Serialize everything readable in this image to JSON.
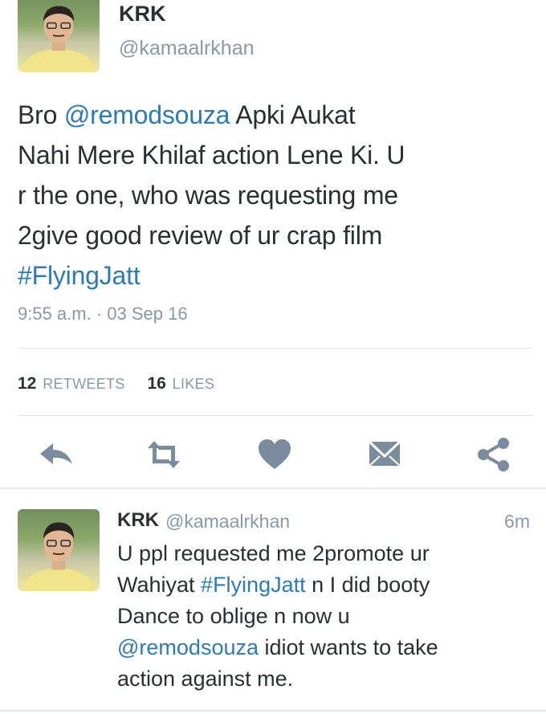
{
  "tweet": {
    "author_name": "KRK",
    "author_handle": "@kamaalrkhan",
    "text_lines": [
      [
        {
          "t": "Bro ",
          "link": false
        },
        {
          "t": "@remodsouza",
          "link": true
        },
        {
          "t": " Apki Aukat",
          "link": false
        }
      ],
      [
        {
          "t": "Nahi Mere Khilaf action Lene Ki. U",
          "link": false
        }
      ],
      [
        {
          "t": "r the one, who was requesting me",
          "link": false
        }
      ],
      [
        {
          "t": "2give good review of ur crap film",
          "link": false
        }
      ],
      [
        {
          "t": "#FlyingJatt",
          "link": true
        }
      ]
    ],
    "timestamp": "9:55 a.m. · 03 Sep 16",
    "retweets_count": "12",
    "retweets_label": "RETWEETS",
    "likes_count": "16",
    "likes_label": "LIKES"
  },
  "actions": [
    {
      "name": "reply-icon"
    },
    {
      "name": "retweet-icon"
    },
    {
      "name": "heart-icon"
    },
    {
      "name": "mail-icon"
    },
    {
      "name": "share-icon"
    }
  ],
  "reply": {
    "author_name": "KRK",
    "author_handle": "@kamaalrkhan",
    "time": "6m",
    "text_lines": [
      [
        {
          "t": "U ppl requested me 2promote ur",
          "link": false
        }
      ],
      [
        {
          "t": "Wahiyat ",
          "link": false
        },
        {
          "t": "#FlyingJatt",
          "link": true
        },
        {
          "t": " n I did booty",
          "link": false
        }
      ],
      [
        {
          "t": "Dance to oblige n now u",
          "link": false
        }
      ],
      [
        {
          "t": "@remodsouza",
          "link": true
        },
        {
          "t": " idiot wants to take",
          "link": false
        }
      ],
      [
        {
          "t": "action against me.",
          "link": false
        }
      ]
    ]
  },
  "colors": {
    "text": "#292f33",
    "muted": "#8899a6",
    "link": "#2b7bb9",
    "icon": "#7a8c9e",
    "divider": "#e1e8ed"
  }
}
